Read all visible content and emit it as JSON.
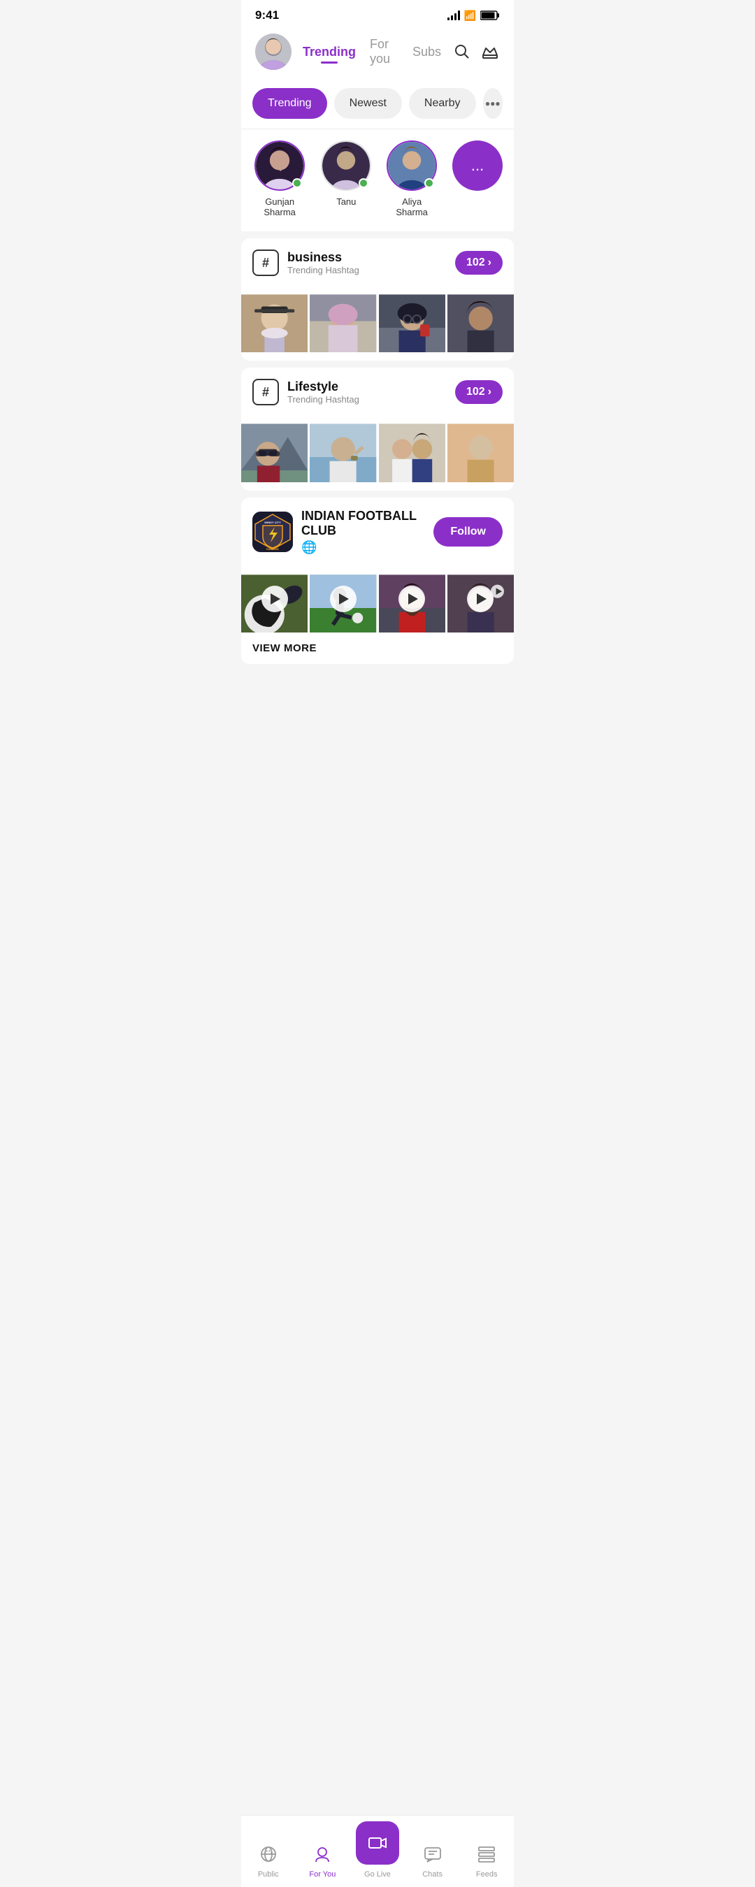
{
  "statusBar": {
    "time": "9:41"
  },
  "header": {
    "tabs": [
      {
        "label": "Trending",
        "active": true
      },
      {
        "label": "For you",
        "active": false
      },
      {
        "label": "Subs",
        "active": false
      }
    ]
  },
  "filterTabs": [
    {
      "label": "Trending",
      "active": true
    },
    {
      "label": "Newest",
      "active": false
    },
    {
      "label": "Nearby",
      "active": false
    }
  ],
  "stories": [
    {
      "name": "Gunjan Sharma",
      "online": true
    },
    {
      "name": "Tanu",
      "online": true
    },
    {
      "name": "Aliya Sharma",
      "online": true
    }
  ],
  "moreButton": "...",
  "hashtags": [
    {
      "tag": "business",
      "subtitle": "Trending Hashtag",
      "count": "102",
      "photos": [
        "#c8a882",
        "#d4b896",
        "#7a6a8a",
        "#b0b0b0"
      ]
    },
    {
      "tag": "Lifestyle",
      "subtitle": "Trending Hashtag",
      "count": "102",
      "photos": [
        "#a8b8c8",
        "#d0d8e0",
        "#c8b0a0",
        "#b8a898"
      ]
    }
  ],
  "club": {
    "name": "INDIAN FOOTBALL CLUB",
    "logoText": "WINDY city",
    "metaIcon": "🌐",
    "followLabel": "Follow",
    "viewMoreLabel": "VIEW MORE",
    "videos": [
      "#3a5a3a",
      "#4a6a3a",
      "#5a4a6a",
      "#6a5a4a"
    ]
  },
  "bottomNav": [
    {
      "label": "Public",
      "icon": "📡",
      "active": false
    },
    {
      "label": "For You",
      "icon": "👤",
      "active": true
    },
    {
      "label": "Go Live",
      "icon": "🎥",
      "active": false,
      "isCenter": true
    },
    {
      "label": "Chats",
      "icon": "💬",
      "active": false
    },
    {
      "label": "Feeds",
      "icon": "📋",
      "active": false
    }
  ]
}
